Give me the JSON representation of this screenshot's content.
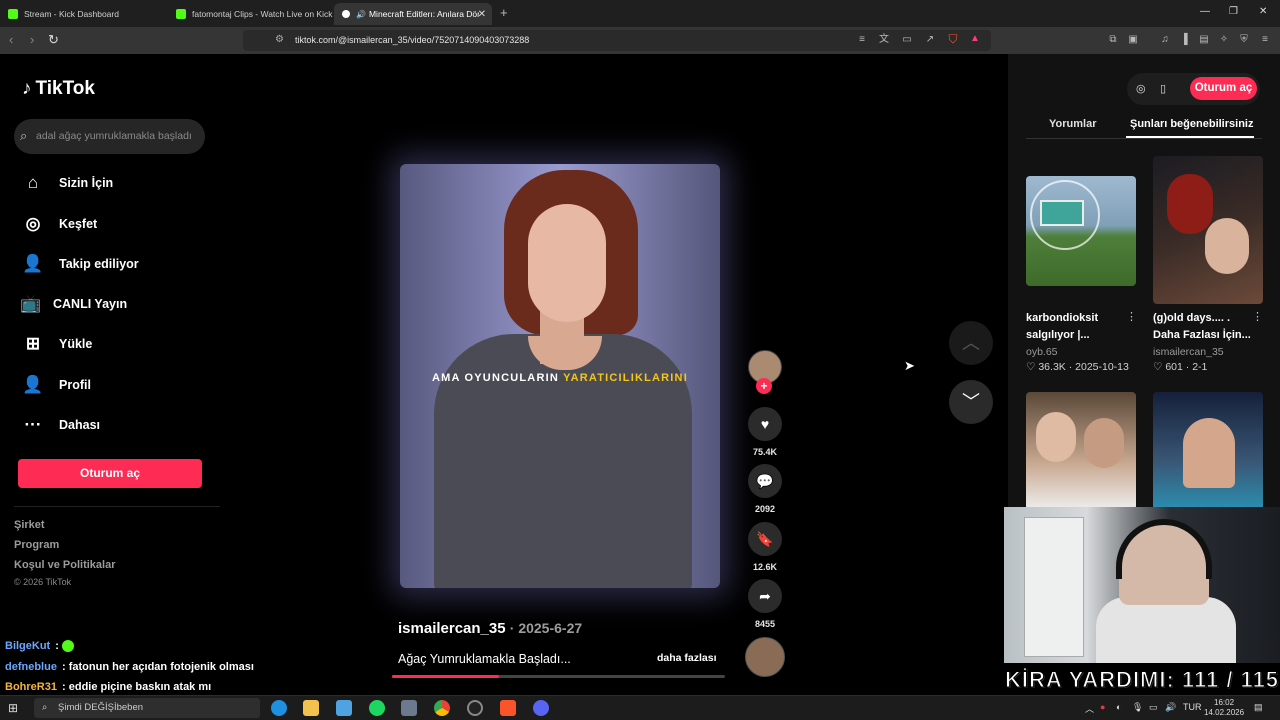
{
  "browser": {
    "tabs": [
      {
        "label": "Stream - Kick Dashboard",
        "icon": "kick-icon"
      },
      {
        "label": "fatomontaj Clips - Watch Live on Kick",
        "icon": "kick-icon"
      },
      {
        "label": "Minecraft Editlerı: Anılara Dön",
        "icon": "tiktok-icon"
      }
    ],
    "url": "tiktok.com/@ismailercan_35/video/7520714090403073288"
  },
  "tiktok": {
    "logo": "TikTok",
    "search_placeholder": "adal ağaç yumruklamakla başladı",
    "nav": [
      {
        "label": "Sizin İçin",
        "icon": "home-icon"
      },
      {
        "label": "Keşfet",
        "icon": "compass-icon"
      },
      {
        "label": "Takip ediliyor",
        "icon": "following-icon"
      },
      {
        "label": "CANLI Yayın",
        "icon": "live-icon"
      },
      {
        "label": "Yükle",
        "icon": "upload-icon"
      },
      {
        "label": "Profil",
        "icon": "profile-icon"
      },
      {
        "label": "Dahası",
        "icon": "more-icon"
      }
    ],
    "login_label": "Oturum aç",
    "footer_links": [
      "Şirket",
      "Program",
      "Koşul ve Politikalar"
    ],
    "copyright": "© 2026 TikTok"
  },
  "chat": [
    {
      "user": "BilgeKut",
      "color": "#6aa7ff",
      "msg": ""
    },
    {
      "user": "defneblue",
      "color": "#6aa7ff",
      "msg": "fatonun her açıdan fotojenik olması"
    },
    {
      "user": "BohreR31",
      "color": "#f5b342",
      "msg": "eddie piçine baskın atak mı"
    }
  ],
  "video": {
    "caption_white": "AMA OYUNCULARIN",
    "caption_yellow": "YARATICILIKLARINI",
    "author": "ismailercan_35",
    "date": "2025-6-27",
    "description": "Ağaç Yumruklamakla Başladı...",
    "more_label": "daha fazlası",
    "progress": 0.32,
    "likes": "75.4K",
    "comments": "2092",
    "saves": "12.6K",
    "shares": "8455"
  },
  "right_panel": {
    "tabs": [
      "Yorumlar",
      "Şunları beğenebilirsiniz"
    ],
    "login_label": "Oturum aç",
    "suggestions": [
      {
        "title1": "karbondioksit",
        "title2": "salgılıyor |...",
        "user": "oyb.65",
        "likes": "36.3K",
        "date": "2025-10-13"
      },
      {
        "title1": "(g)old days.... .",
        "title2": "Daha Fazlası İçin...",
        "user": "ismailercan_35",
        "likes": "601",
        "date": "2-1"
      }
    ]
  },
  "overlay": {
    "kira_text": "KİRA YARDIMI:  111 / 115"
  },
  "taskbar": {
    "search_placeholder": "Şimdi DEĞİŞİbeben",
    "lang": "TUR",
    "time": "16:02",
    "date": "14.02.2026"
  }
}
